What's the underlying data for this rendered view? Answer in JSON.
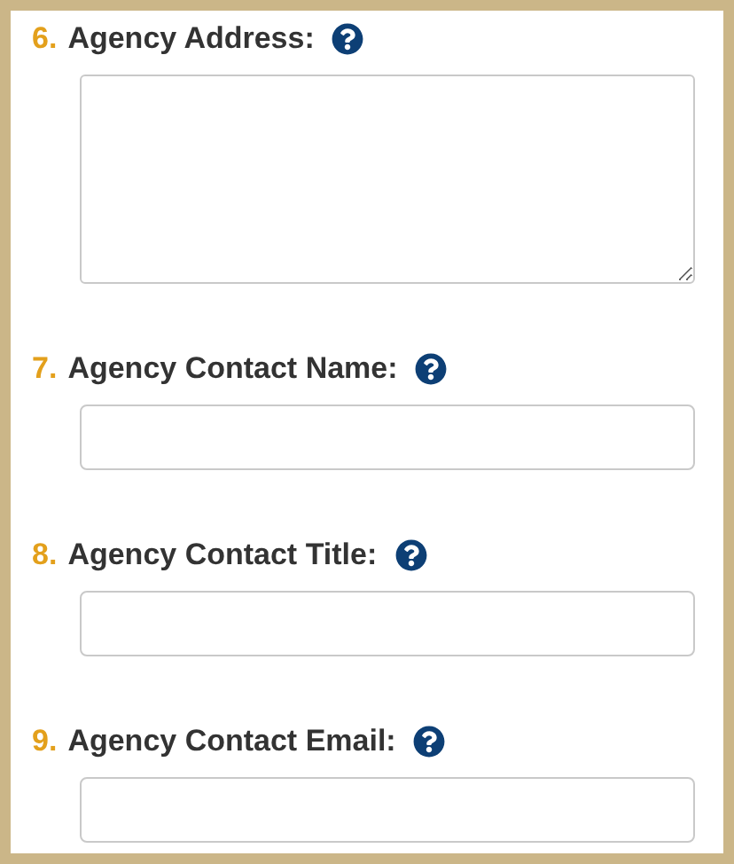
{
  "fields": [
    {
      "number": "6.",
      "label": "Agency Address:",
      "kind": "textarea"
    },
    {
      "number": "7.",
      "label": "Agency Contact Name:",
      "kind": "input"
    },
    {
      "number": "8.",
      "label": "Agency Contact Title:",
      "kind": "input"
    },
    {
      "number": "9.",
      "label": "Agency Contact Email:",
      "kind": "input"
    }
  ]
}
